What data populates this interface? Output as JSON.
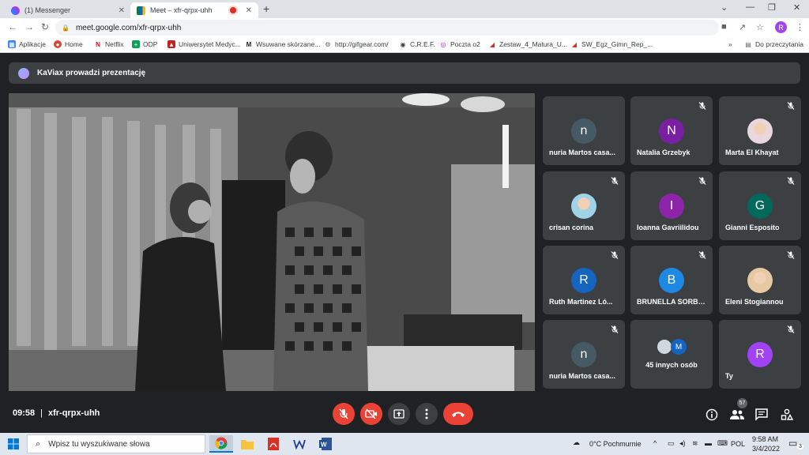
{
  "browser": {
    "tabs": [
      {
        "title": "(1) Messenger",
        "active": false
      },
      {
        "title": "Meet – xfr-qrpx-uhh",
        "active": true
      }
    ],
    "url": "meet.google.com/xfr-qrpx-uhh",
    "profile_initial": "R",
    "bookmarks": [
      {
        "label": "Aplikacje",
        "icon": "apps-grid-icon",
        "color": "#4285f4"
      },
      {
        "label": "Home",
        "icon": "home-icon",
        "color": "#db4437"
      },
      {
        "label": "Netflix",
        "icon": "netflix-icon",
        "color": "#e50914"
      },
      {
        "label": "ODP",
        "icon": "plus-icon",
        "color": "#0f9d58"
      },
      {
        "label": "Uniwersytet Medyc...",
        "icon": "university-icon",
        "color": "#c5221f"
      },
      {
        "label": "Wsuwane skórzane...",
        "icon": "mark-icon",
        "color": "#202124"
      },
      {
        "label": "http://gifgear.com/",
        "icon": "gear-icon",
        "color": "#5f6368"
      },
      {
        "label": "C.R.E.F.",
        "icon": "globe-icon",
        "color": "#3c4043"
      },
      {
        "label": "Poczta o2",
        "icon": "mail-icon",
        "color": "#9c27b0"
      },
      {
        "label": "Zestaw_4_Matura_U...",
        "icon": "pdf-icon",
        "color": "#d93025"
      },
      {
        "label": "SW_Egz_Gimn_Rep_...",
        "icon": "pdf-icon",
        "color": "#d93025"
      }
    ],
    "other_bookmarks": "Do przeczytania"
  },
  "meet": {
    "presenter_text": "KaViax prowadzi prezentację",
    "participants": [
      {
        "name": "nuria Martos casa...",
        "initial": "n",
        "color": "#455a64",
        "muted": false,
        "photo": false
      },
      {
        "name": "Natalia Grzebyk",
        "initial": "N",
        "color": "#7b1fa2",
        "muted": true,
        "photo": false
      },
      {
        "name": "Marta El Khayat",
        "initial": "",
        "color": "#e8d7dc",
        "muted": true,
        "photo": true
      },
      {
        "name": "crisan corina",
        "initial": "",
        "color": "#9fd3e8",
        "muted": true,
        "photo": true
      },
      {
        "name": "Ioanna Gavriilidou",
        "initial": "I",
        "color": "#8e24aa",
        "muted": true,
        "photo": false
      },
      {
        "name": "Gianni Esposito",
        "initial": "G",
        "color": "#00695c",
        "muted": true,
        "photo": false
      },
      {
        "name": "Ruth Martinez Ló...",
        "initial": "R",
        "color": "#1565c0",
        "muted": true,
        "photo": false
      },
      {
        "name": "BRUNELLA SORBE...",
        "initial": "B",
        "color": "#1e88e5",
        "muted": true,
        "photo": false
      },
      {
        "name": "Eleni Stogiannou",
        "initial": "",
        "color": "#e6c9a2",
        "muted": true,
        "photo": true
      },
      {
        "name": "nuria Martos casa...",
        "initial": "n",
        "color": "#455a64",
        "muted": true,
        "photo": false
      },
      {
        "name": "45 innych osób",
        "initial": "M",
        "color": "#1565c0",
        "muted": false,
        "photo": false
      },
      {
        "name": "Ty",
        "initial": "R",
        "color": "#a142f4",
        "muted": true,
        "photo": false
      }
    ],
    "time": "09:58",
    "meeting_code": "xfr-qrpx-uhh",
    "people_count": "57"
  },
  "taskbar": {
    "search_placeholder": "Wpisz tu wyszukiwane słowa",
    "weather": "0°C  Pochmurnie",
    "language": "POL",
    "clock_time": "9:58 AM",
    "clock_date": "3/4/2022",
    "notifications": "3"
  }
}
